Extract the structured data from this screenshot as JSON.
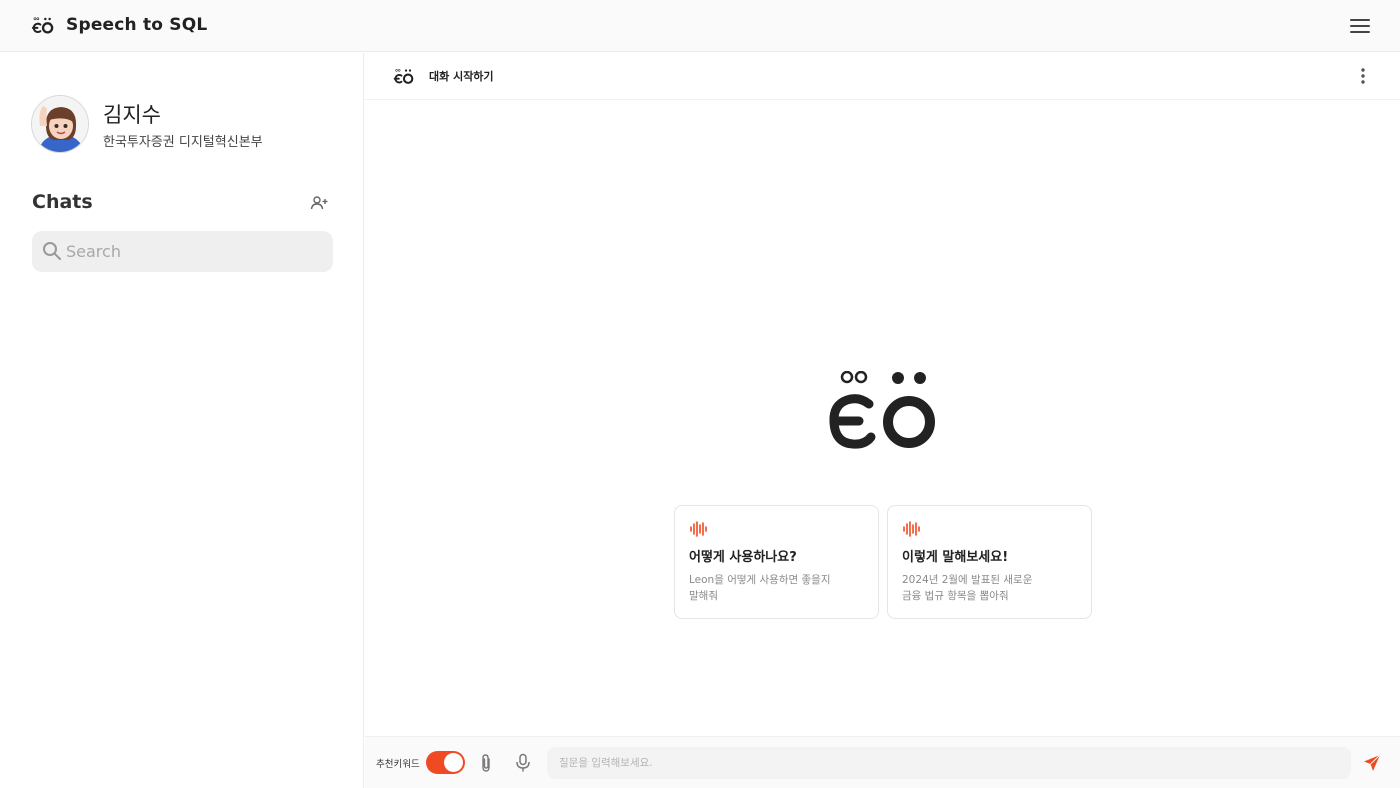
{
  "app": {
    "title": "Speech to SQL",
    "logo_text": "ëö"
  },
  "colors": {
    "accent": "#f04a22",
    "text_dark": "#222222",
    "sidebar_border": "#ececec",
    "search_bg": "#efefef"
  },
  "icons": {
    "menu": "hamburger-menu-icon",
    "add_user": "add-user-icon",
    "search": "search-icon",
    "more": "kebab-more-icon",
    "wave": "sound-wave-icon",
    "attach": "paperclip-icon",
    "mic": "microphone-icon",
    "send": "send-paper-plane-icon"
  },
  "profile": {
    "name": "김지수",
    "org": "한국투자증권 디지털혁신본부"
  },
  "sidebar": {
    "chats_title": "Chats",
    "search_placeholder": "Search"
  },
  "chat": {
    "header_title": "대화 시작하기",
    "cards": [
      {
        "title": "어떻게 사용하나요?",
        "desc_line1": "Leon을 어떻게 사용하면 좋을지",
        "desc_line2": "말해줘"
      },
      {
        "title": "이렇게 말해보세요!",
        "desc_line1": "2024년 2월에 발표된 새로운",
        "desc_line2": "금융 법규 항목을 뽑아줘"
      }
    ]
  },
  "input_bar": {
    "keyword_label": "추천키워드",
    "keyword_toggle_on": true,
    "placeholder": "질문을 입력해보세요."
  }
}
